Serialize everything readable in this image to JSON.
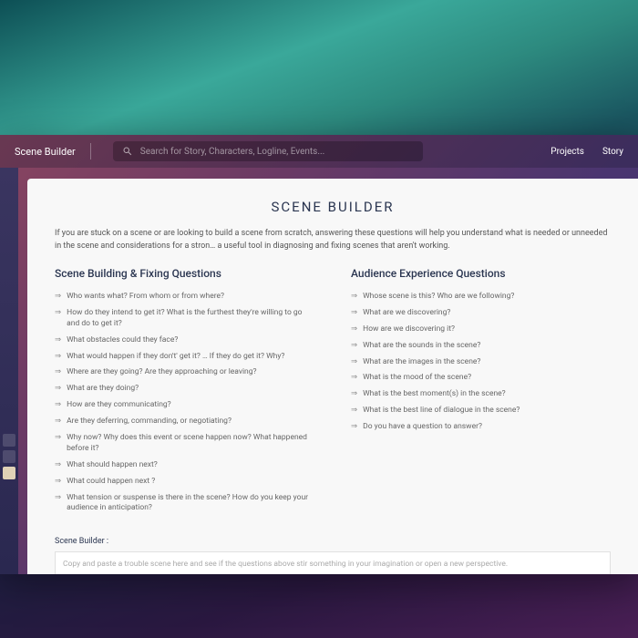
{
  "topbar": {
    "title": "Scene Builder",
    "search_placeholder": "Search for Story, Characters, Logline, Events...",
    "nav": {
      "projects": "Projects",
      "story": "Story"
    }
  },
  "page": {
    "title": "SCENE BUILDER",
    "intro": "If you are stuck on a scene or are looking to build a scene from scratch, answering these questions will help you understand what is needed or unneeded in the scene and considerations for a stron… a useful tool in diagnosing and fixing scenes that aren't working."
  },
  "col_left": {
    "heading": "Scene Building & Fixing Questions",
    "q": [
      "Who wants what? From whom or from where?",
      "How do they intend to get it? What is the furthest they're willing to go and do to get it?",
      "What obstacles could they face?",
      "What would happen if they don't' get it? … If they do get it? Why?",
      "Where are they going? Are they approaching or leaving?",
      "What are they doing?",
      "How are they communicating?",
      "Are they deferring, commanding, or negotiating?",
      "Why now? Why does this event or scene happen now? What happened before it?",
      "What should happen next?",
      "What could happen next ?",
      "What tension or suspense is there in the scene? How do you keep your audience in anticipation?"
    ]
  },
  "col_right": {
    "heading": "Audience Experience Questions",
    "q": [
      "Whose scene is this? Who are we following?",
      "What are we discovering?",
      "How are we discovering it?",
      "What are the sounds in the scene?",
      "What are the images in the scene?",
      "What is the mood of the scene?",
      "What is the best moment(s) in the scene?",
      "What is the best line of dialogue in the scene?",
      "Do you have a question to answer?"
    ]
  },
  "builder": {
    "label": "Scene Builder :",
    "placeholder": "Copy and paste a trouble scene here and see if the questions above stir something in your imagination or open a new perspective."
  }
}
